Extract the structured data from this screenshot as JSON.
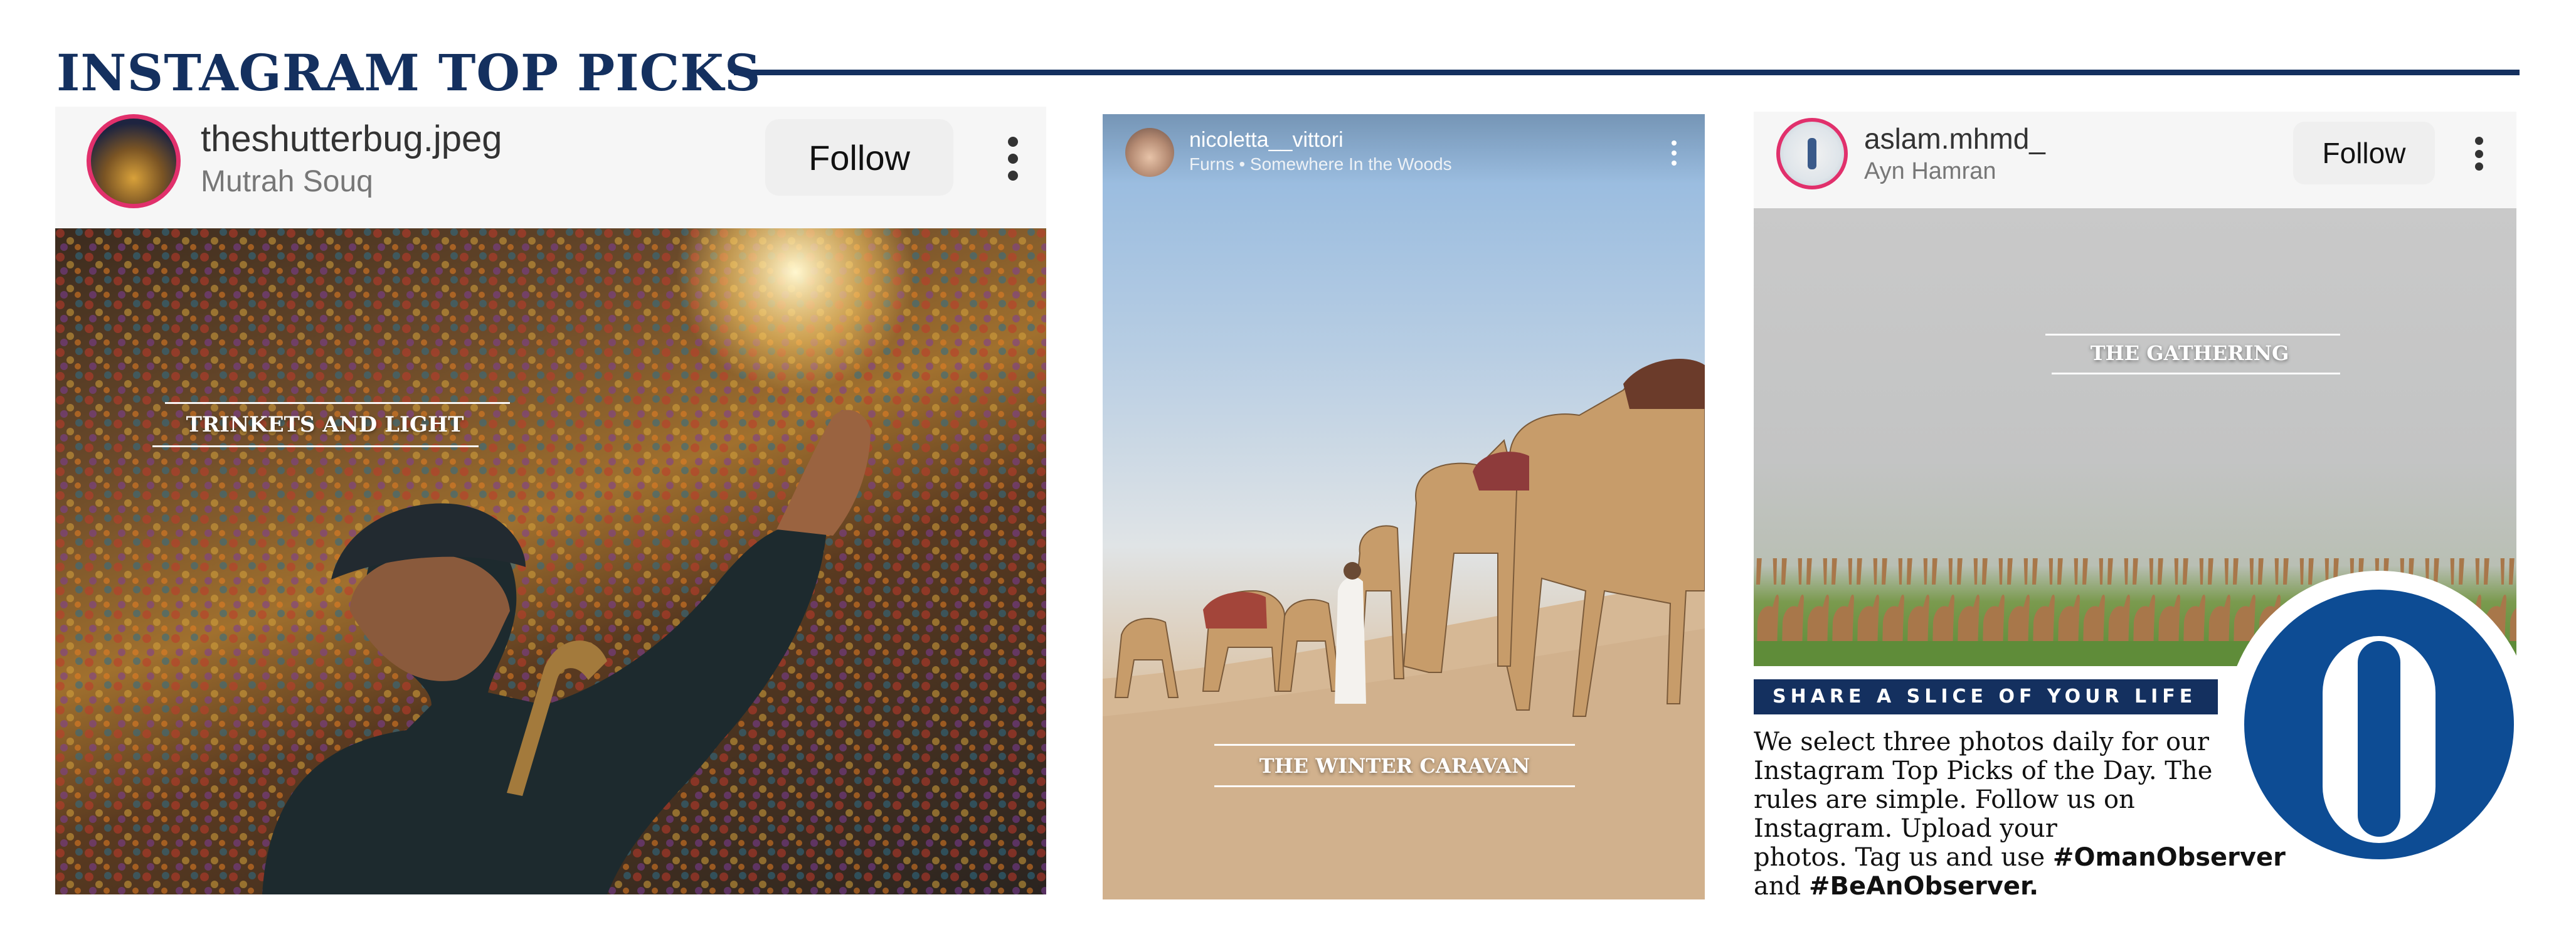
{
  "header": {
    "title": "INSTAGRAM TOP PICKS"
  },
  "posts": [
    {
      "username": "theshutterbug.jpeg",
      "location": "Mutrah Souq",
      "follow_label": "Follow",
      "caption": "TRINKETS AND LIGHT"
    },
    {
      "username": "nicoletta__vittori",
      "location": "Furns • Somewhere In the Woods",
      "caption": "THE WINTER CARAVAN"
    },
    {
      "username": "aslam.mhmd_",
      "location": "Ayn Hamran",
      "follow_label": "Follow",
      "caption": "THE GATHERING"
    }
  ],
  "promo": {
    "banner": "SHARE A SLICE OF YOUR LIFE",
    "lines": [
      "We select three photos daily for our",
      "Instagram Top Picks of the Day. The",
      "rules are simple. Follow us on",
      "Instagram. Upload your",
      "photos. Tag us and use",
      "and"
    ],
    "hashtag_1": "#OmanObserver",
    "hashtag_2": "#BeAnObserver."
  },
  "logo": {
    "letter": "O",
    "color": "#0d4c94"
  },
  "colors": {
    "navy": "#14305f",
    "logo_blue": "#0d4c94"
  }
}
